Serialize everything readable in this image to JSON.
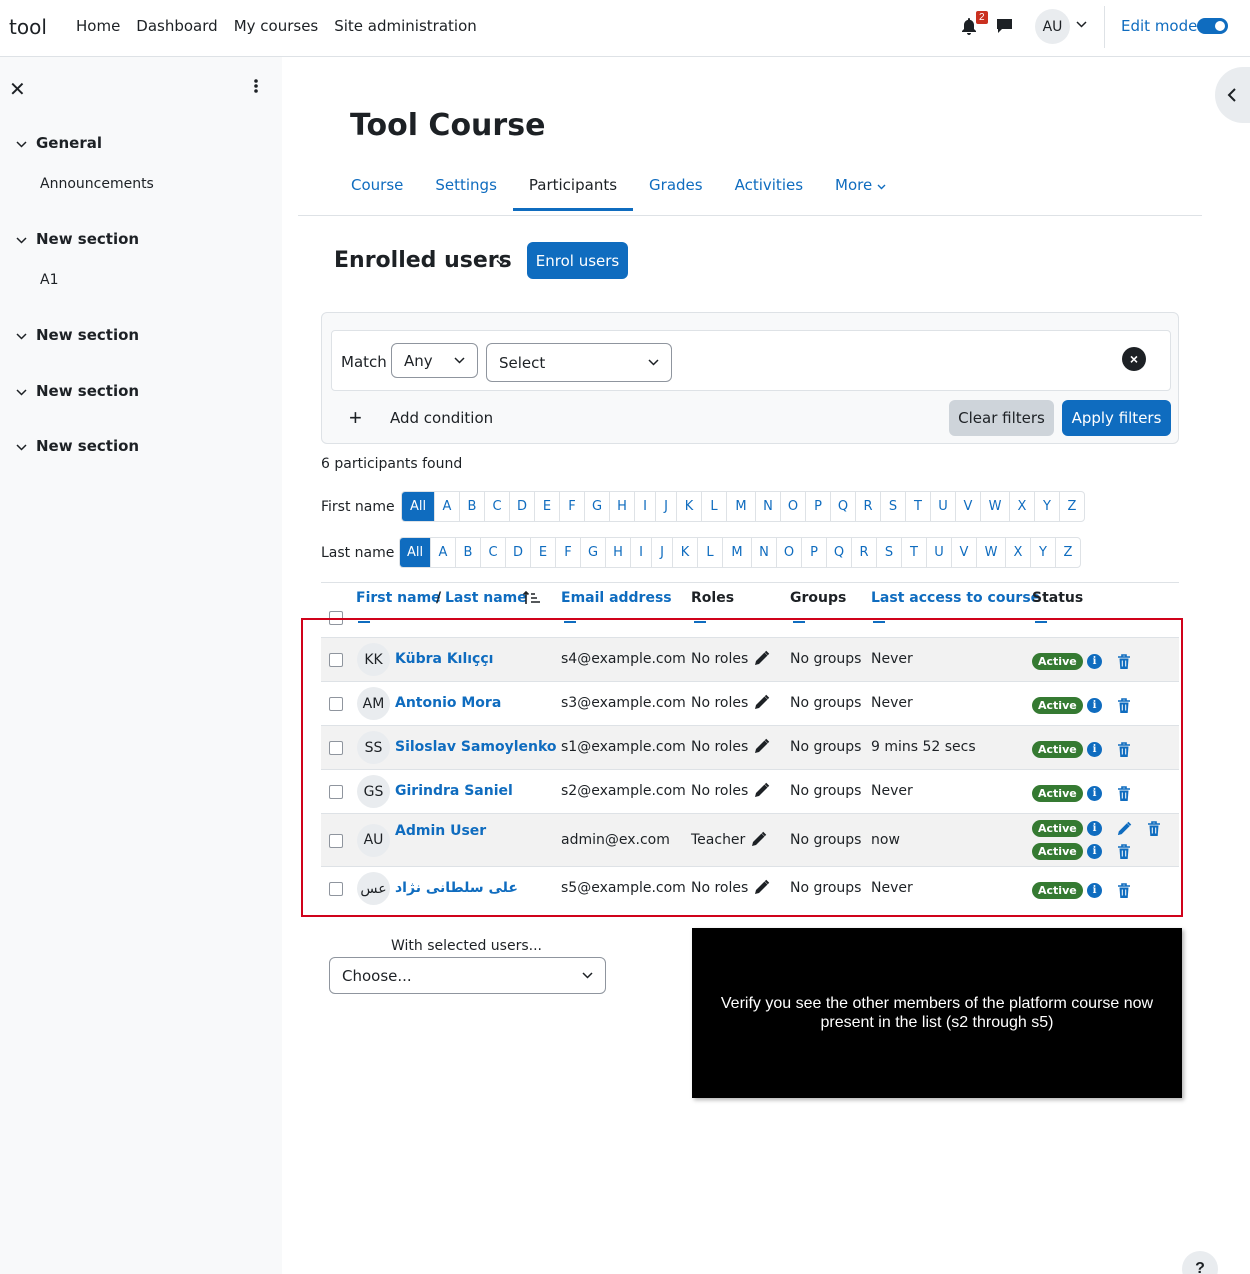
{
  "navbar": {
    "brand": "tool",
    "items": [
      "Home",
      "Dashboard",
      "My courses",
      "Site administration"
    ],
    "notification_count": "2",
    "user_initials": "AU",
    "edit_mode_label": "Edit mode",
    "edit_mode_on": true
  },
  "drawer": {
    "sections": [
      {
        "title": "General",
        "items": [
          "Announcements"
        ]
      },
      {
        "title": "New section",
        "items": [
          "A1"
        ]
      },
      {
        "title": "New section",
        "items": []
      },
      {
        "title": "New section",
        "items": []
      },
      {
        "title": "New section",
        "items": []
      }
    ]
  },
  "page": {
    "title": "Tool Course",
    "tabs": [
      "Course",
      "Settings",
      "Participants",
      "Grades",
      "Activities",
      "More"
    ],
    "active_tab": "Participants",
    "heading": "Enrolled users",
    "enrol_button": "Enrol users"
  },
  "filters": {
    "match_label": "Match",
    "match_value": "Any",
    "type_value": "Select",
    "add_condition": "Add condition",
    "clear_button": "Clear filters",
    "apply_button": "Apply filters"
  },
  "participants_found": "6 participants found",
  "initials": {
    "first_name_label": "First name",
    "last_name_label": "Last name",
    "all_label": "All",
    "letters": [
      "A",
      "B",
      "C",
      "D",
      "E",
      "F",
      "G",
      "H",
      "I",
      "J",
      "K",
      "L",
      "M",
      "N",
      "O",
      "P",
      "Q",
      "R",
      "S",
      "T",
      "U",
      "V",
      "W",
      "X",
      "Y",
      "Z"
    ]
  },
  "table": {
    "headers": {
      "first_name": "First name",
      "separator": "/",
      "last_name": "Last name",
      "email": "Email address",
      "roles": "Roles",
      "groups": "Groups",
      "last_access": "Last access to course",
      "status": "Status"
    },
    "rows": [
      {
        "initials": "KK",
        "name": "Kübra Kılıççı",
        "email": "s4@example.com",
        "roles": "No roles",
        "groups": "No groups",
        "last_access": "Never",
        "status": [
          "Active"
        ]
      },
      {
        "initials": "AM",
        "name": "Antonio Mora",
        "email": "s3@example.com",
        "roles": "No roles",
        "groups": "No groups",
        "last_access": "Never",
        "status": [
          "Active"
        ]
      },
      {
        "initials": "SS",
        "name": "Siloslav Samoylenko",
        "email": "s1@example.com",
        "roles": "No roles",
        "groups": "No groups",
        "last_access": "9 mins 52 secs",
        "status": [
          "Active"
        ]
      },
      {
        "initials": "GS",
        "name": "Girindra Saniel",
        "email": "s2@example.com",
        "roles": "No roles",
        "groups": "No groups",
        "last_access": "Never",
        "status": [
          "Active"
        ]
      },
      {
        "initials": "AU",
        "name": "Admin User",
        "email": "admin@ex.com",
        "roles": "Teacher",
        "groups": "No groups",
        "last_access": "now",
        "status": [
          "Active",
          "Active"
        ]
      },
      {
        "initials": "عس",
        "name": "علی سلطانی نژاد",
        "email": "s5@example.com",
        "roles": "No roles",
        "groups": "No groups",
        "last_access": "Never",
        "status": [
          "Active"
        ]
      }
    ]
  },
  "bulk": {
    "label": "With selected users...",
    "value": "Choose..."
  },
  "overlay_text": "Verify you see the other members of the platform course now present in the list (s2 through s5)",
  "help_label": "?"
}
